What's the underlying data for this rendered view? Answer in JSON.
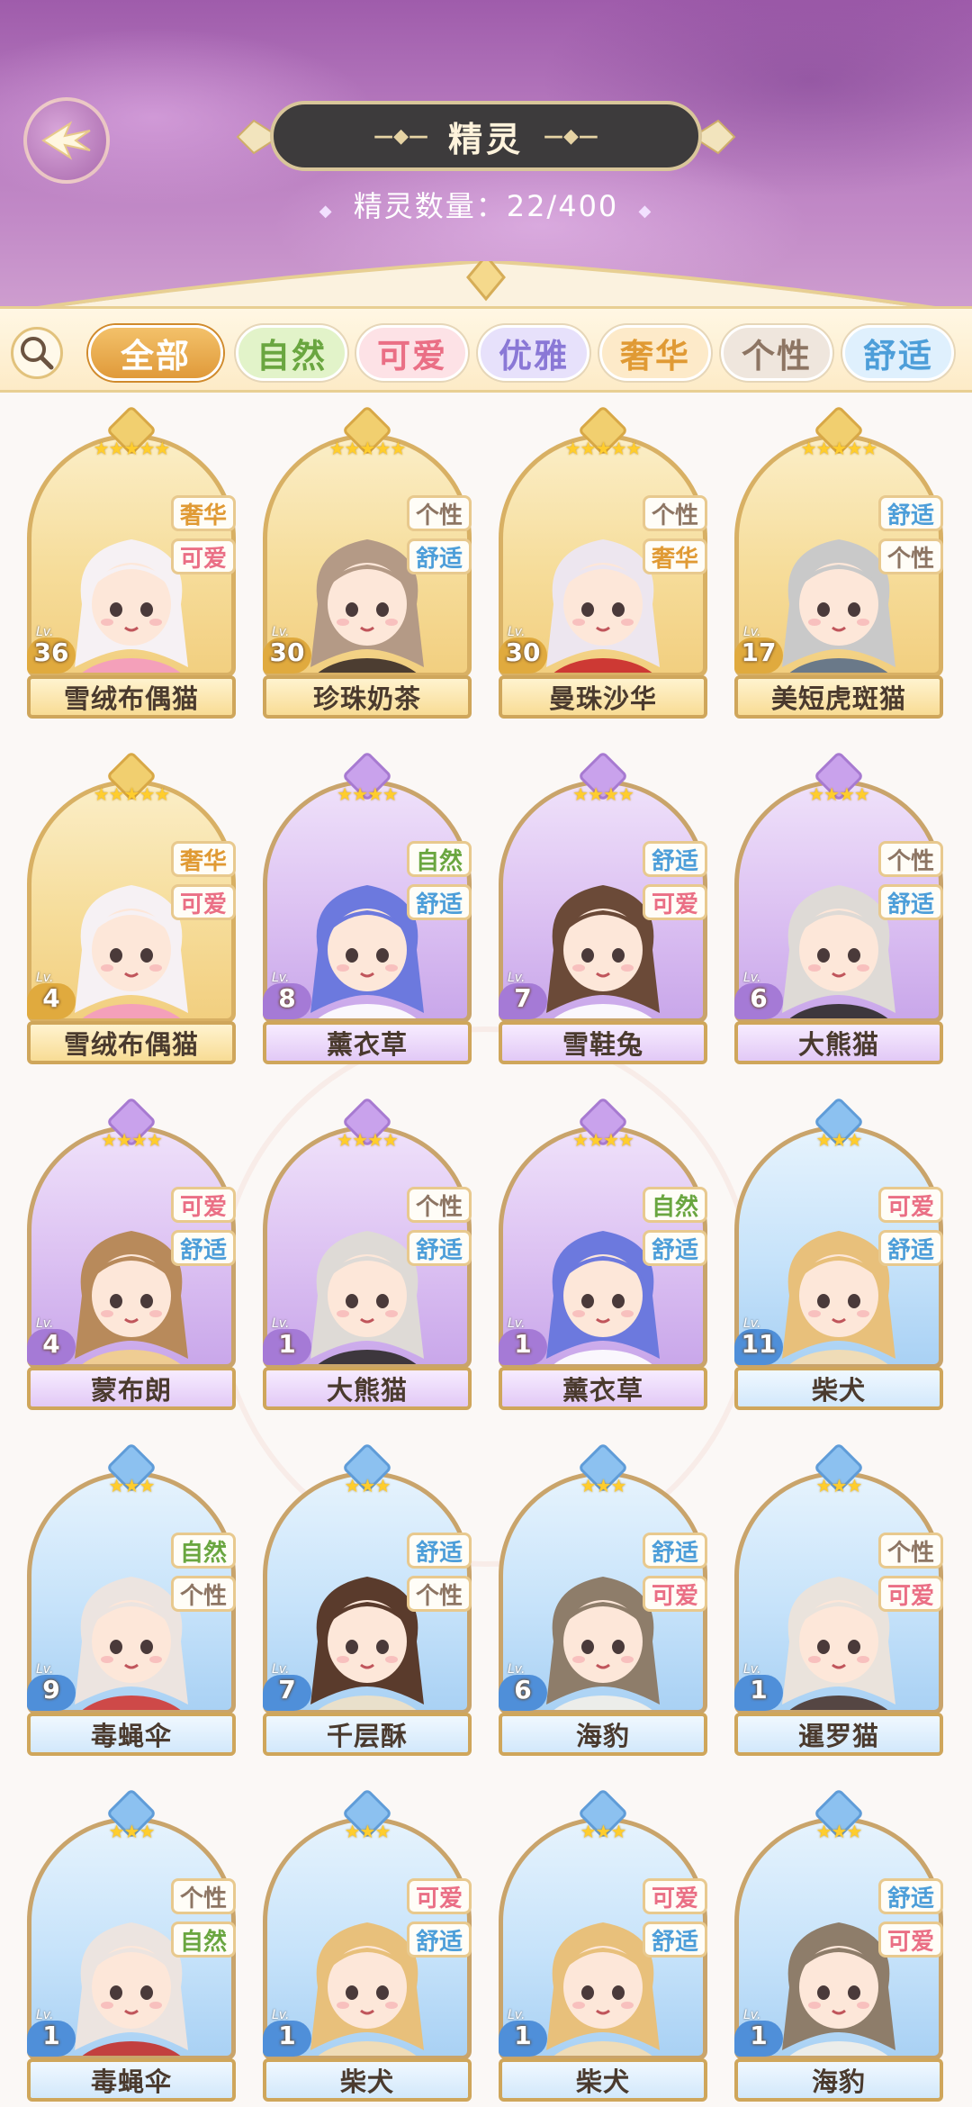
{
  "header": {
    "title": "精灵",
    "count_label": "精灵数量：22/400"
  },
  "filters": [
    {
      "label": "全部",
      "active": true,
      "color": "#e2a24f",
      "text": "#ffffff"
    },
    {
      "label": "自然",
      "active": false,
      "color": "#e2f3c9",
      "text": "#6aa640"
    },
    {
      "label": "可爱",
      "active": false,
      "color": "#fde2e6",
      "text": "#ea6f85"
    },
    {
      "label": "优雅",
      "active": false,
      "color": "#e7e1fb",
      "text": "#8a78d6"
    },
    {
      "label": "奢华",
      "active": false,
      "color": "#fdeac9",
      "text": "#e09a34"
    },
    {
      "label": "个性",
      "active": false,
      "color": "#efe6dd",
      "text": "#8d7563"
    },
    {
      "label": "舒适",
      "active": false,
      "color": "#dff0fd",
      "text": "#4d9ed9"
    }
  ],
  "tag_colors": {
    "奢华": "#e09a34",
    "可爱": "#ea6f85",
    "个性": "#8d7563",
    "舒适": "#4d9ed9",
    "自然": "#6aa640"
  },
  "spirits": [
    {
      "name": "雪绒布偶猫",
      "level": "36",
      "stars": 5,
      "rarity": "gold",
      "tags": [
        "奢华",
        "可爱"
      ],
      "hair": "#f6f1f4",
      "accent": "#f49ac0"
    },
    {
      "name": "珍珠奶茶",
      "level": "30",
      "stars": 5,
      "rarity": "gold",
      "tags": [
        "个性",
        "舒适"
      ],
      "hair": "#b49a86",
      "accent": "#3a2c28"
    },
    {
      "name": "曼珠沙华",
      "level": "30",
      "stars": 5,
      "rarity": "gold",
      "tags": [
        "个性",
        "奢华"
      ],
      "hair": "#ede6ef",
      "accent": "#c9282b"
    },
    {
      "name": "美短虎斑猫",
      "level": "17",
      "stars": 5,
      "rarity": "gold",
      "tags": [
        "舒适",
        "个性"
      ],
      "hair": "#c9c9c9",
      "accent": "#5b6f8a"
    },
    {
      "name": "雪绒布偶猫",
      "level": "4",
      "stars": 5,
      "rarity": "gold",
      "tags": [
        "奢华",
        "可爱"
      ],
      "hair": "#f6f1f4",
      "accent": "#f49ac0"
    },
    {
      "name": "薰衣草",
      "level": "8",
      "stars": 4,
      "rarity": "purple",
      "tags": [
        "自然",
        "舒适"
      ],
      "hair": "#6c79de",
      "accent": "#ffffff"
    },
    {
      "name": "雪鞋兔",
      "level": "7",
      "stars": 4,
      "rarity": "purple",
      "tags": [
        "舒适",
        "可爱"
      ],
      "hair": "#6b4a38",
      "accent": "#ffffff"
    },
    {
      "name": "大熊猫",
      "level": "6",
      "stars": 4,
      "rarity": "purple",
      "tags": [
        "个性",
        "舒适"
      ],
      "hair": "#dedad6",
      "accent": "#2d2a2a"
    },
    {
      "name": "蒙布朗",
      "level": "4",
      "stars": 4,
      "rarity": "purple",
      "tags": [
        "可爱",
        "舒适"
      ],
      "hair": "#b88a5b",
      "accent": "#f3d08a"
    },
    {
      "name": "大熊猫",
      "level": "1",
      "stars": 4,
      "rarity": "purple",
      "tags": [
        "个性",
        "舒适"
      ],
      "hair": "#dedad6",
      "accent": "#2d2a2a"
    },
    {
      "name": "薰衣草",
      "level": "1",
      "stars": 4,
      "rarity": "purple",
      "tags": [
        "自然",
        "舒适"
      ],
      "hair": "#6c79de",
      "accent": "#ffffff"
    },
    {
      "name": "柴犬",
      "level": "11",
      "stars": 3,
      "rarity": "blue",
      "tags": [
        "可爱",
        "舒适"
      ],
      "hair": "#e8c07b",
      "accent": "#f6ddb0"
    },
    {
      "name": "毒蝇伞",
      "level": "9",
      "stars": 3,
      "rarity": "blue",
      "tags": [
        "自然",
        "个性"
      ],
      "hair": "#ece4e0",
      "accent": "#d13a35"
    },
    {
      "name": "千层酥",
      "level": "7",
      "stars": 3,
      "rarity": "blue",
      "tags": [
        "舒适",
        "个性"
      ],
      "hair": "#5a3b2c",
      "accent": "#f0e1c6"
    },
    {
      "name": "海豹",
      "level": "6",
      "stars": 3,
      "rarity": "blue",
      "tags": [
        "舒适",
        "可爱"
      ],
      "hair": "#8e7d6a",
      "accent": "#f3efe9"
    },
    {
      "name": "暹罗猫",
      "level": "1",
      "stars": 3,
      "rarity": "blue",
      "tags": [
        "个性",
        "可爱"
      ],
      "hair": "#eae3dc",
      "accent": "#4b3630"
    },
    {
      "name": "毒蝇伞",
      "level": "1",
      "stars": 3,
      "rarity": "blue",
      "tags": [
        "个性",
        "自然"
      ],
      "hair": "#ece4e0",
      "accent": "#c4302b"
    },
    {
      "name": "柴犬",
      "level": "1",
      "stars": 3,
      "rarity": "blue",
      "tags": [
        "可爱",
        "舒适"
      ],
      "hair": "#e8c07b",
      "accent": "#f6ddb0"
    },
    {
      "name": "柴犬",
      "level": "1",
      "stars": 3,
      "rarity": "blue",
      "tags": [
        "可爱",
        "舒适"
      ],
      "hair": "#e8c07b",
      "accent": "#f6ddb0"
    },
    {
      "name": "海豹",
      "level": "1",
      "stars": 3,
      "rarity": "blue",
      "tags": [
        "舒适",
        "可爱"
      ],
      "hair": "#8e7d6a",
      "accent": "#f3efe9"
    }
  ]
}
